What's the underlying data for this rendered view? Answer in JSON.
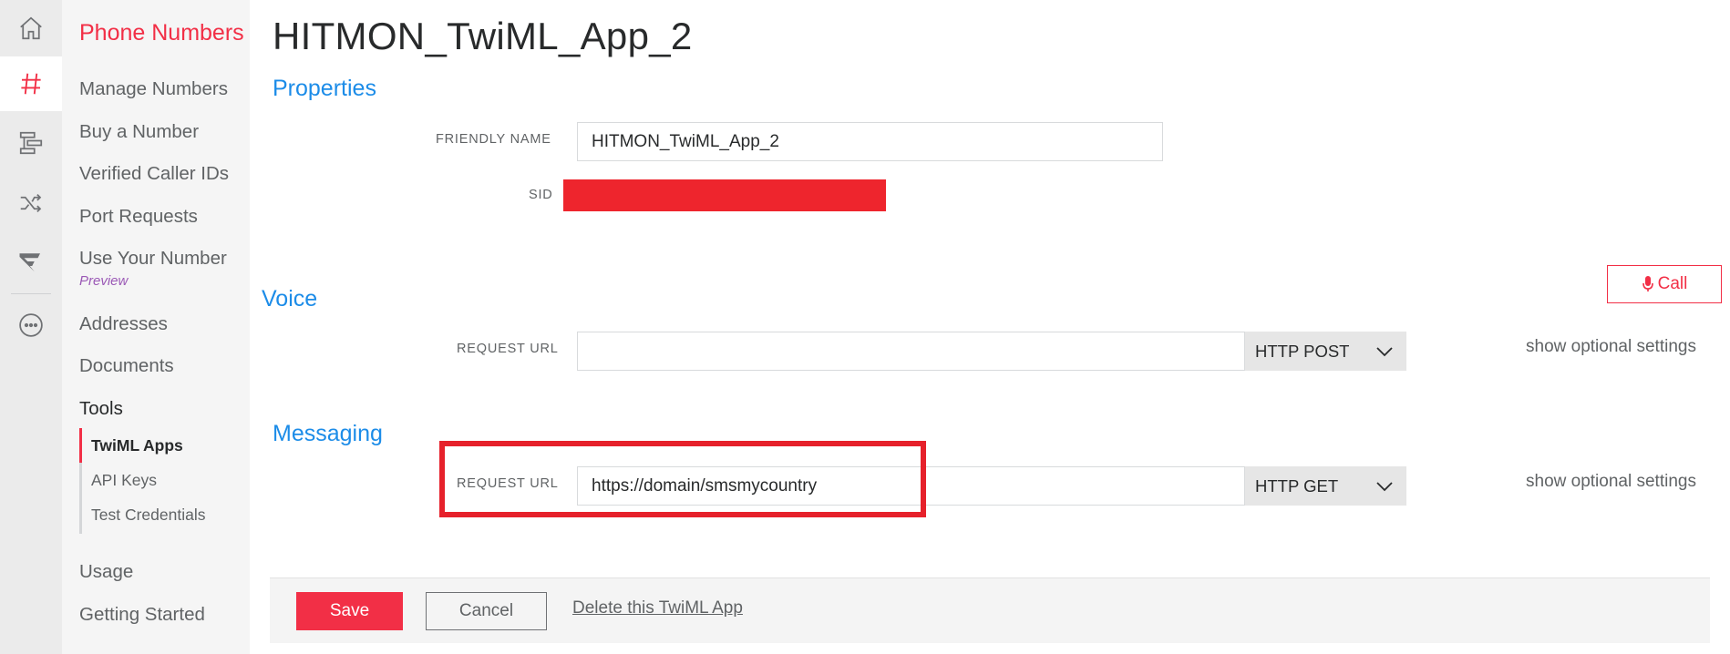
{
  "rail": {
    "icons": [
      "home-icon",
      "hash-icon",
      "studio-icon",
      "shuffle-icon",
      "flex-icon",
      "more-icon"
    ]
  },
  "sidebar": {
    "title": "Phone Numbers",
    "items": {
      "manage": "Manage Numbers",
      "buy": "Buy a Number",
      "verified": "Verified Caller IDs",
      "port": "Port Requests",
      "use_your_number": "Use Your Number",
      "preview": "Preview",
      "addresses": "Addresses",
      "documents": "Documents",
      "tools": "Tools",
      "usage": "Usage",
      "getting_started": "Getting Started"
    },
    "tools_sub": {
      "twiml_apps": "TwiML Apps",
      "api_keys": "API Keys",
      "test_credentials": "Test Credentials"
    }
  },
  "page": {
    "title": "HITMON_TwiML_App_2"
  },
  "properties": {
    "section_title": "Properties",
    "friendly_name_label": "FRIENDLY NAME",
    "friendly_name_value": "HITMON_TwiML_App_2",
    "sid_label": "SID"
  },
  "voice": {
    "section_title": "Voice",
    "call_label": "Call",
    "request_url_label": "REQUEST URL",
    "request_url_value": "",
    "method": "HTTP POST",
    "optional_link": "show optional settings"
  },
  "messaging": {
    "section_title": "Messaging",
    "request_url_label": "REQUEST URL",
    "request_url_value": "https://domain/smsmycountry",
    "method": "HTTP GET",
    "optional_link": "show optional settings"
  },
  "footer": {
    "save_label": "Save",
    "cancel_label": "Cancel",
    "delete_label": "Delete this TwiML App"
  },
  "colors": {
    "brand_red": "#f22f46",
    "link_blue": "#1c8ce8",
    "highlight_red": "#e6212b",
    "preview_purple": "#9b59b6"
  }
}
